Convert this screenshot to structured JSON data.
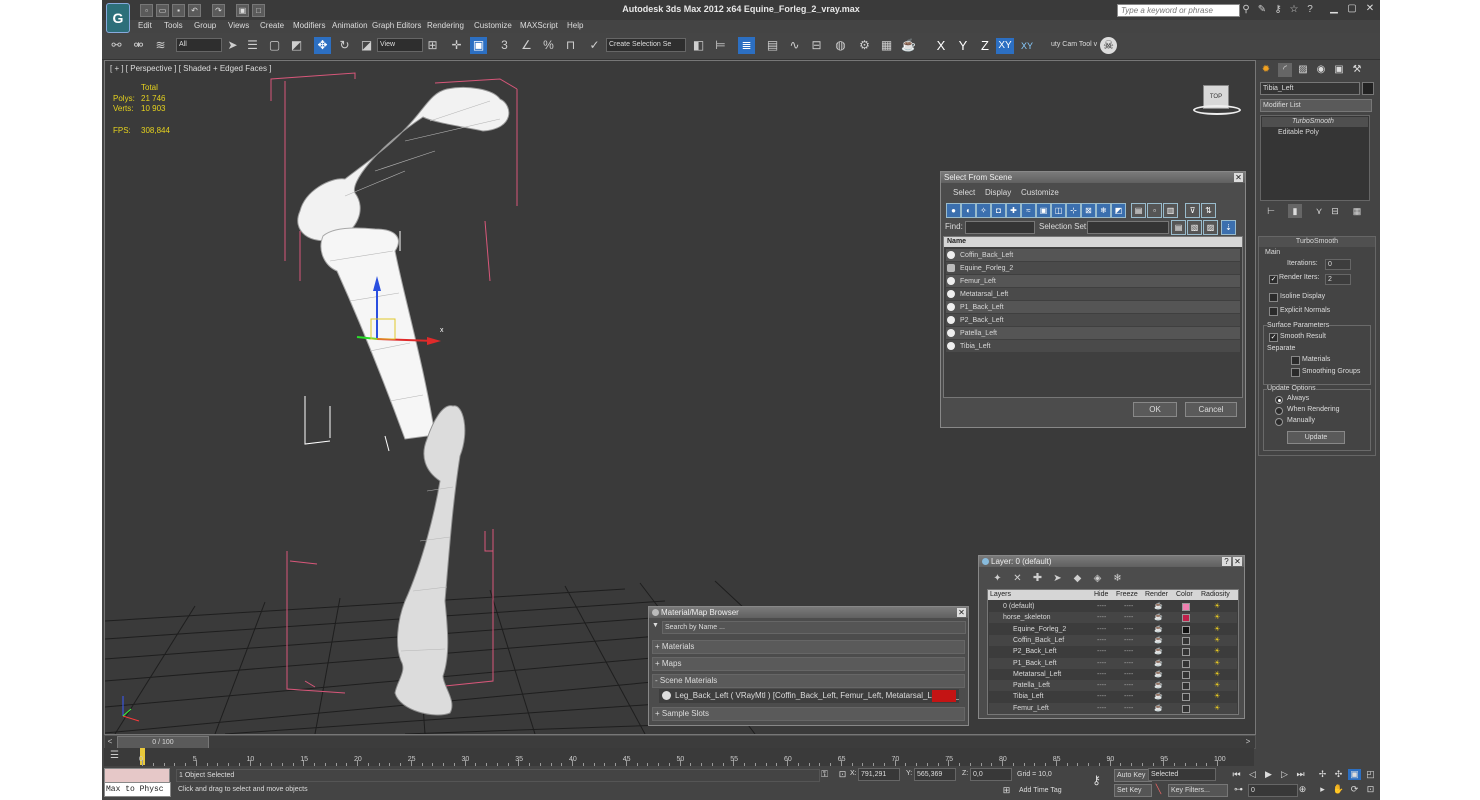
{
  "window": {
    "title": "Autodesk 3ds Max  2012 x64    Equine_Forleg_2_vray.max",
    "search_placeholder": "Type a keyword or phrase"
  },
  "menu": [
    "Edit",
    "Tools",
    "Group",
    "Views",
    "Create",
    "Modifiers",
    "Animation",
    "Graph Editors",
    "Rendering",
    "Customize",
    "MAXScript",
    "Help"
  ],
  "toolbar": {
    "filter": "All",
    "ref_coord": "View",
    "selection_set": "Create Selection Se",
    "snap_label": "3",
    "pct_label": "%",
    "axes": [
      "X",
      "Y",
      "Z",
      "XY",
      "XY"
    ],
    "tool_label": "uty Cam Tool v"
  },
  "viewport": {
    "label": "[ + ] [ Perspective ] [ Shaded + Edged Faces ]",
    "stats": {
      "total_label": "Total",
      "polys_label": "Polys:",
      "polys_value": "21 746",
      "verts_label": "Verts:",
      "verts_value": "10 903",
      "fps_label": "FPS:",
      "fps_value": "308,844"
    },
    "gizmo_x": "x",
    "cube_label": "TOP",
    "colors": {
      "background": "#3a3a3a",
      "grid": "#1e1e1e",
      "bbox": "#d8577a",
      "selection": "#ffffff",
      "stats": "#e5d21e"
    }
  },
  "select_from_scene": {
    "title": "Select From Scene",
    "menu": [
      "Select",
      "Display",
      "Customize"
    ],
    "find_label": "Find:",
    "selection_set_label": "Selection Set:",
    "column_name": "Name",
    "items": [
      "Coffin_Back_Left",
      "Equine_Forleg_2",
      "Femur_Left",
      "Metatarsal_Left",
      "P1_Back_Left",
      "P2_Back_Left",
      "Patella_Left",
      "Tibia_Left"
    ],
    "ok": "OK",
    "cancel": "Cancel"
  },
  "layer_dialog": {
    "title": "Layer: 0 (default)",
    "help": "?",
    "columns": [
      "Layers",
      "Hide",
      "Freeze",
      "Render",
      "Color",
      "Radiosity"
    ],
    "rows": [
      {
        "name": "0 (default)",
        "indent": 0,
        "color": "#f080b0"
      },
      {
        "name": "horse_skeleton",
        "indent": 0,
        "color": "#c0204a"
      },
      {
        "name": "Equine_Forleg_2",
        "indent": 1,
        "color": "#111111"
      },
      {
        "name": "Coffin_Back_Lef",
        "indent": 1,
        "color": "#333333"
      },
      {
        "name": "P2_Back_Left",
        "indent": 1,
        "color": "#333333"
      },
      {
        "name": "P1_Back_Left",
        "indent": 1,
        "color": "#333333"
      },
      {
        "name": "Metatarsal_Left",
        "indent": 1,
        "color": "#333333"
      },
      {
        "name": "Patella_Left",
        "indent": 1,
        "color": "#333333"
      },
      {
        "name": "Tibia_Left",
        "indent": 1,
        "color": "#333333"
      },
      {
        "name": "Femur_Left",
        "indent": 1,
        "color": "#333333"
      }
    ],
    "dash": "----"
  },
  "material_browser": {
    "title": "Material/Map Browser",
    "search_placeholder": "Search by Name ...",
    "sections": [
      "+ Materials",
      "+ Maps",
      "- Scene Materials"
    ],
    "scene_material": "Leg_Back_Left  ( VRayMtl ) [Coffin_Back_Left, Femur_Left, Metatarsal_Left, P1_",
    "sample_slots": "+ Sample Slots"
  },
  "command_panel": {
    "object_name": "Tibia_Left",
    "modifier_list": "Modifier List",
    "stack": [
      "TurboSmooth",
      "Editable Poly"
    ],
    "rollout_title": "TurboSmooth",
    "main_label": "Main",
    "iterations_label": "Iterations:",
    "iterations_value": "0",
    "render_iters_label": "Render Iters:",
    "render_iters_value": "2",
    "isoline": "Isoline Display",
    "explicit": "Explicit Normals",
    "surface_params": "Surface Parameters",
    "smooth_result": "Smooth Result",
    "separate": "Separate",
    "materials": "Materials",
    "smoothing_groups": "Smoothing Groups",
    "update_options": "Update Options",
    "always": "Always",
    "when_rendering": "When Rendering",
    "manually": "Manually",
    "update_btn": "Update"
  },
  "timeline": {
    "frame": "0 / 100",
    "ticks": [
      "0",
      "5",
      "10",
      "15",
      "20",
      "25",
      "30",
      "35",
      "40",
      "45",
      "50",
      "55",
      "60",
      "65",
      "70",
      "75",
      "80",
      "85",
      "90",
      "95",
      "100"
    ]
  },
  "status": {
    "maxscript": "Max to Physc",
    "objects_selected": "1 Object Selected",
    "prompt": "Click and drag to select and move objects",
    "x_label": "X:",
    "x_value": "791,291",
    "y_label": "Y:",
    "y_value": "565,369",
    "z_label": "Z:",
    "z_value": "0,0",
    "grid": "Grid = 10,0",
    "add_time_tag": "Add Time Tag",
    "auto_key": "Auto Key",
    "selected": "Selected",
    "set_key": "Set Key",
    "key_filters": "Key Filters...",
    "frame_field": "0"
  }
}
